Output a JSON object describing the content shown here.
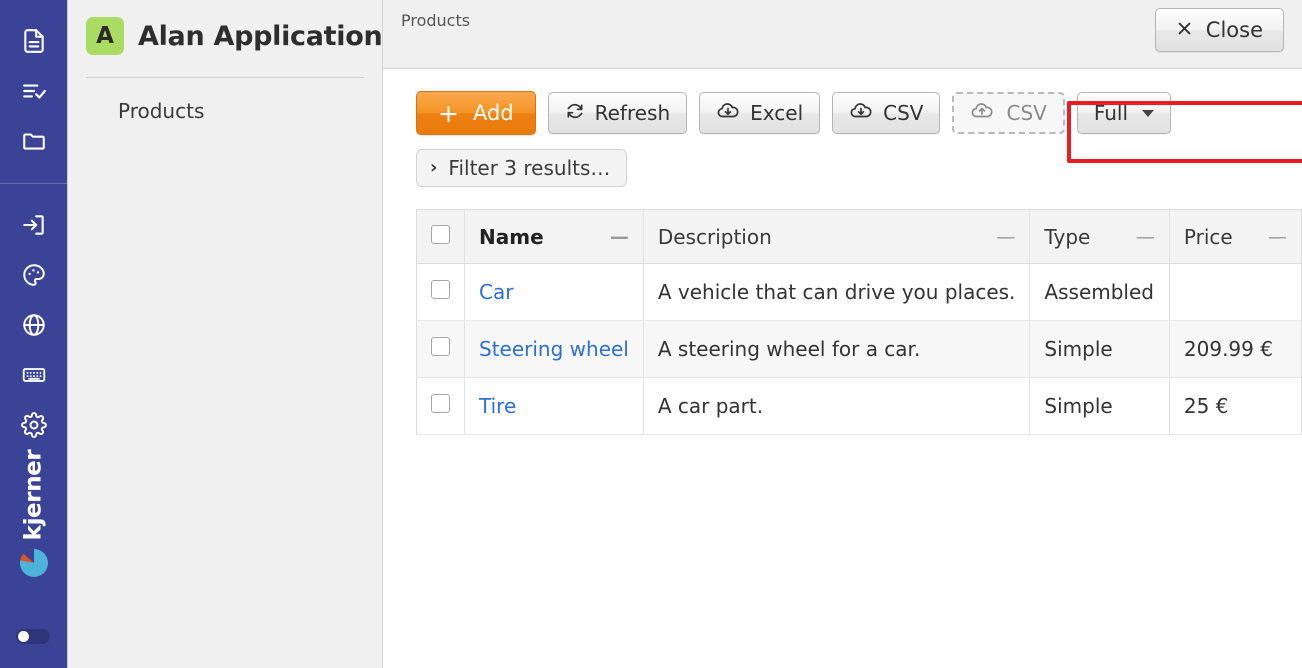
{
  "rail": {
    "top_icons": [
      {
        "name": "document-icon",
        "label": "Document"
      },
      {
        "name": "task-list-icon",
        "label": "Tasks"
      },
      {
        "name": "folder-icon",
        "label": "Folder"
      }
    ],
    "bottom_icons": [
      {
        "name": "login-icon",
        "label": "Login"
      },
      {
        "name": "palette-icon",
        "label": "Theme"
      },
      {
        "name": "globe-icon",
        "label": "Language"
      },
      {
        "name": "keyboard-icon",
        "label": "Keyboard"
      },
      {
        "name": "gear-icon",
        "label": "Settings"
      }
    ],
    "brand": "kjerner",
    "brand_color": "#3B4396",
    "toggle_on": false
  },
  "navpanel": {
    "app_badge_letter": "A",
    "app_badge_color": "#AADC63",
    "app_title": "Alan Application",
    "items": [
      {
        "label": "Products"
      }
    ]
  },
  "topbar": {
    "breadcrumb": "Products",
    "close_label": "Close",
    "close_icon": "close-icon"
  },
  "toolbar": {
    "add_label": "Add",
    "add_plus": "+",
    "add_color": "#EF8113",
    "refresh_label": "Refresh",
    "refresh_icon": "refresh-icon",
    "excel_label": "Excel",
    "excel_icon": "cloud-download-icon",
    "csv_download_label": "CSV",
    "csv_download_icon": "cloud-download-icon",
    "csv_upload_label": "CSV",
    "csv_upload_icon": "cloud-upload-icon",
    "view_mode_label": "Full",
    "highlight_color": "#ED1C24"
  },
  "filter": {
    "chevron": "›",
    "label": "Filter 3 results…"
  },
  "table": {
    "columns": [
      {
        "key": "check",
        "label": ""
      },
      {
        "key": "name",
        "label": "Name",
        "sorted": true,
        "menu": "—"
      },
      {
        "key": "description",
        "label": "Description",
        "sorted": false,
        "menu": "—"
      },
      {
        "key": "type",
        "label": "Type",
        "sorted": false,
        "menu": "—"
      },
      {
        "key": "price",
        "label": "Price",
        "sorted": false,
        "menu": "—"
      }
    ],
    "rows": [
      {
        "name": "Car",
        "description": "A vehicle that can drive you places.",
        "type": "Assembled",
        "price": ""
      },
      {
        "name": "Steering wheel",
        "description": "A steering wheel for a car.",
        "type": "Simple",
        "price": "209.99 €"
      },
      {
        "name": "Tire",
        "description": "A car part.",
        "type": "Simple",
        "price": "25 €"
      }
    ]
  }
}
